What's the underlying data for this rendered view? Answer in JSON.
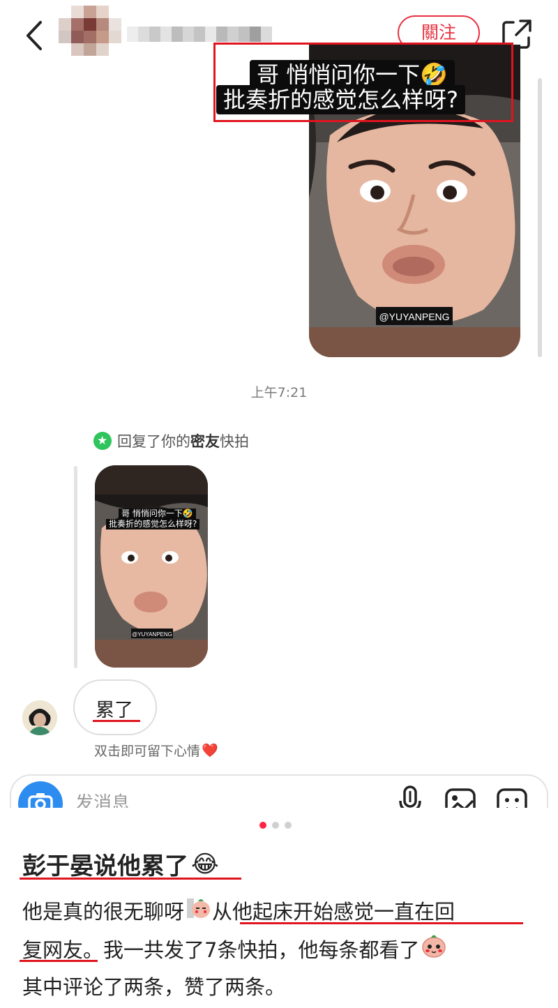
{
  "header": {
    "follow_label": "關注"
  },
  "snap_large": {
    "caption_line1": "哥 悄悄问你一下",
    "caption_line2": "批奏折的感觉怎么样呀?",
    "watermark": "@YUYANPENG"
  },
  "chat": {
    "timestamp": "上午7:21",
    "reply_note_prefix": "回复了你的",
    "reply_note_bold": "密友",
    "reply_note_suffix": "快拍",
    "snap_small": {
      "caption_line1": "哥 悄悄问你一下",
      "caption_line2": "批奏折的感觉怎么样呀?",
      "watermark": "@YUYANPENG"
    },
    "message_text": "累了",
    "doubletap_hint": "双击即可留下心情"
  },
  "input_bar": {
    "placeholder": "发消息"
  },
  "pagination": {
    "count": 3,
    "active_index": 0
  },
  "post": {
    "title": "彭于晏说他累了",
    "line1_a": "他是真的很无聊呀",
    "line1_b": "从他起床开始感觉一直在回",
    "line2_a": "复网友",
    "line2_b": "。我一共发了7条快拍，他每条都看了",
    "line3": "其中评论了两条，赞了两条。"
  },
  "colors": {
    "brand_red": "#ff2442",
    "annotation_red": "#e0141e",
    "camera_blue": "#2d8cf0",
    "friend_green": "#2fc45c"
  }
}
